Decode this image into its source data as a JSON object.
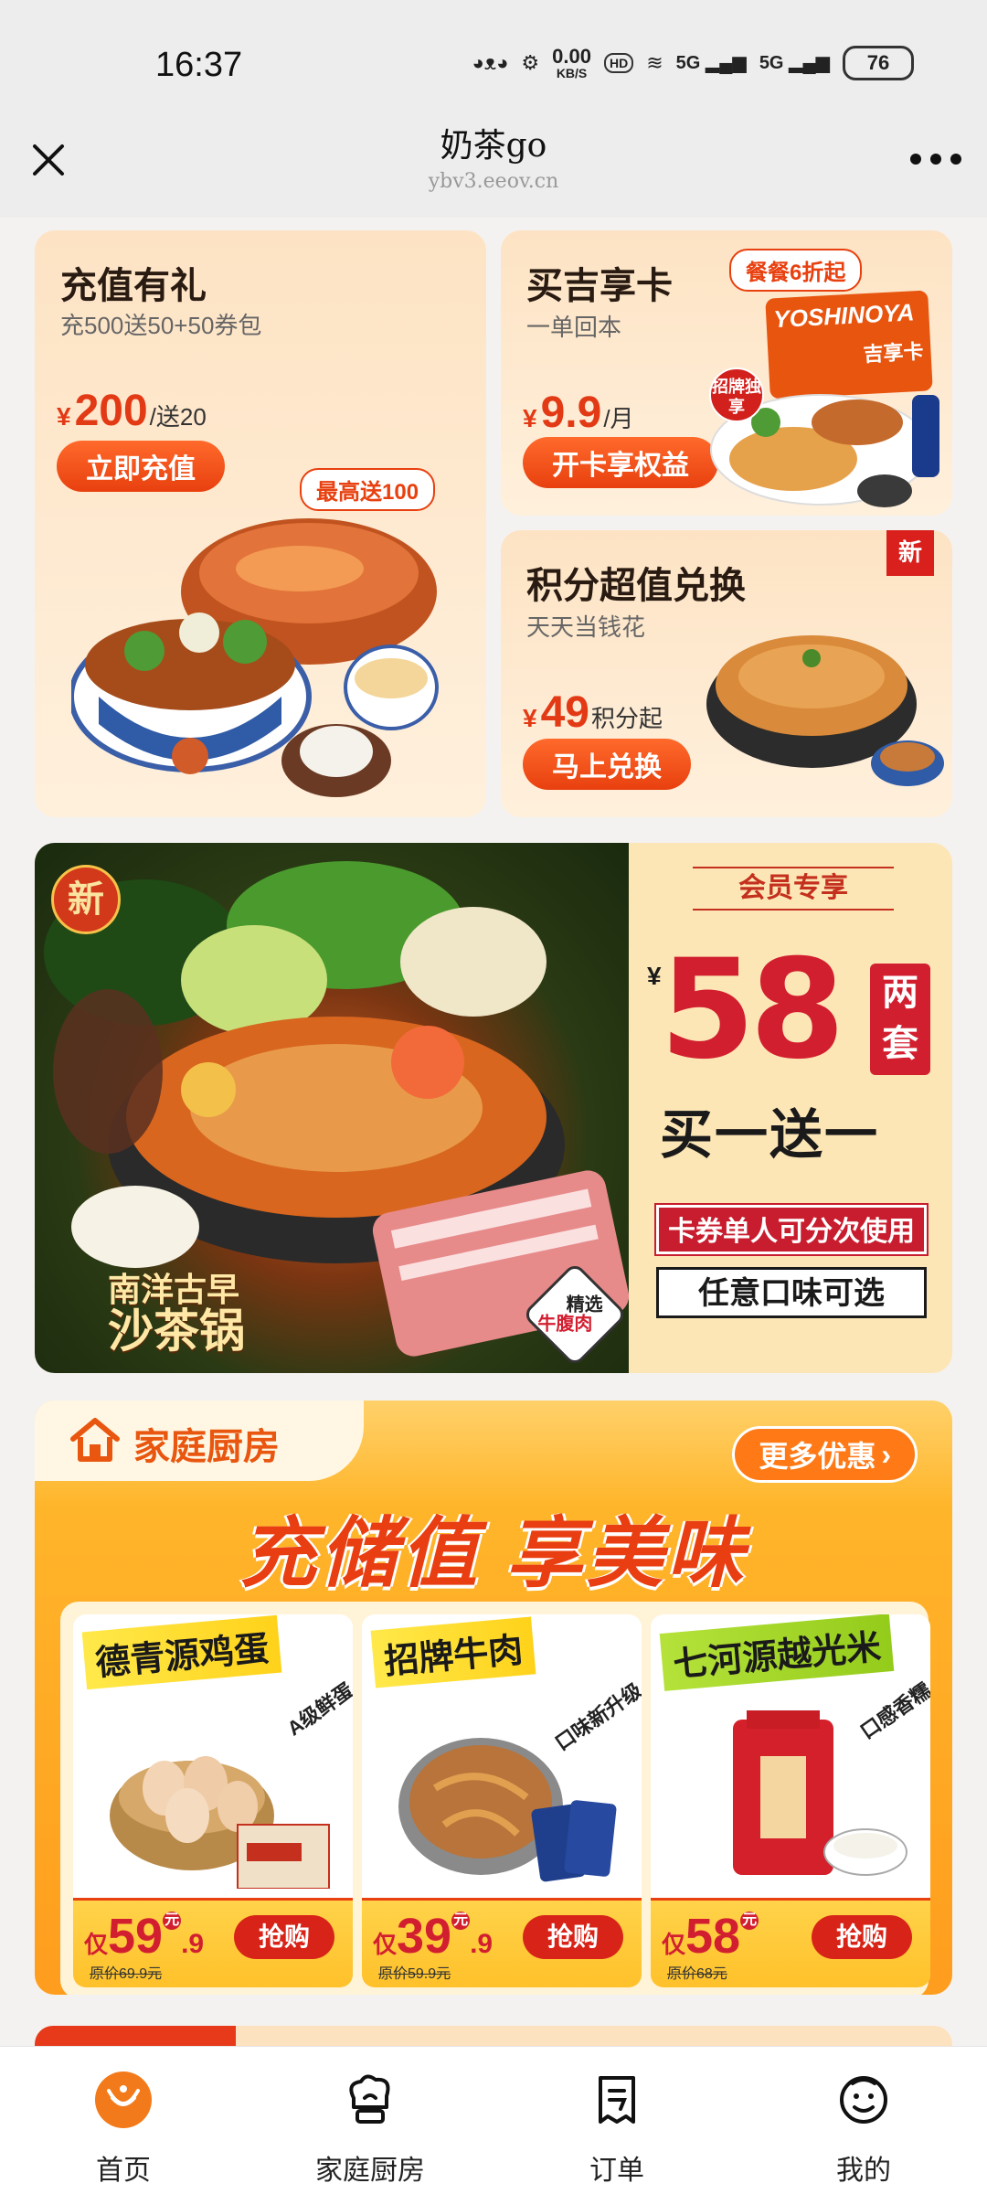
{
  "status": {
    "time": "16:37",
    "speed_value": "0.00",
    "speed_unit": "KB/S",
    "hd": "HD",
    "net1": "5G",
    "net2": "5G",
    "battery": "76"
  },
  "nav": {
    "title": "奶茶go",
    "url": "ybv3.eeov.cn"
  },
  "promo_recharge": {
    "title": "充值有礼",
    "subtitle": "充500送50+50券包",
    "price_symbol": "¥",
    "price": "200",
    "price_suffix": "/送20",
    "button": "立即充值",
    "tag": "最高送100"
  },
  "promo_card": {
    "title": "买吉享卡",
    "subtitle": "一单回本",
    "price_symbol": "¥",
    "price": "9.9",
    "price_suffix": "/月",
    "button": "开卡享权益",
    "tag": "餐餐6折起",
    "brand": "YOSHINOYA",
    "card_label": "吉享卡",
    "badge": "招牌独享"
  },
  "promo_points": {
    "title": "积分超值兑换",
    "subtitle": "天天当钱花",
    "price_symbol": "¥",
    "price": "49",
    "price_suffix": "积分起",
    "button": "马上兑换",
    "ribbon": "新"
  },
  "hotpot": {
    "new_badge": "新",
    "name_line1": "南洋古早",
    "name_line2": "沙茶锅",
    "beef_tag_line1": "精选",
    "beef_tag_line2": "牛腹肉",
    "member_tag": "会员专享",
    "price_symbol": "¥",
    "price": "58",
    "sets": "两套",
    "offer": "买一送一",
    "note1": "卡券单人可分次使用",
    "note2": "任意口味可选"
  },
  "family_kitchen": {
    "title": "家庭厨房",
    "more": "更多优惠",
    "slogan": "充储值 享美味",
    "products": [
      {
        "name": "德青源鸡蛋",
        "side": "A级鲜蛋",
        "pre": "仅",
        "price_int": "59",
        "price_dec": ".9",
        "yuan": "元",
        "orig": "原价69.9元",
        "buy": "抢购"
      },
      {
        "name": "招牌牛肉",
        "side": "口味新升级",
        "pre": "仅",
        "price_int": "39",
        "price_dec": ".9",
        "yuan": "元",
        "orig": "原价59.9元",
        "buy": "抢购"
      },
      {
        "name": "七河源越光米",
        "side": "口感香糯",
        "pre": "仅",
        "price_int": "58",
        "price_dec": "",
        "yuan": "元",
        "orig": "原价68元",
        "buy": "抢购"
      }
    ]
  },
  "tabs": [
    {
      "label": "首页"
    },
    {
      "label": "家庭厨房"
    },
    {
      "label": "订单"
    },
    {
      "label": "我的"
    }
  ],
  "colors": {
    "accent": "#e8400f",
    "price_red": "#d21f30",
    "kitchen_orange": "#ff9d1e"
  }
}
